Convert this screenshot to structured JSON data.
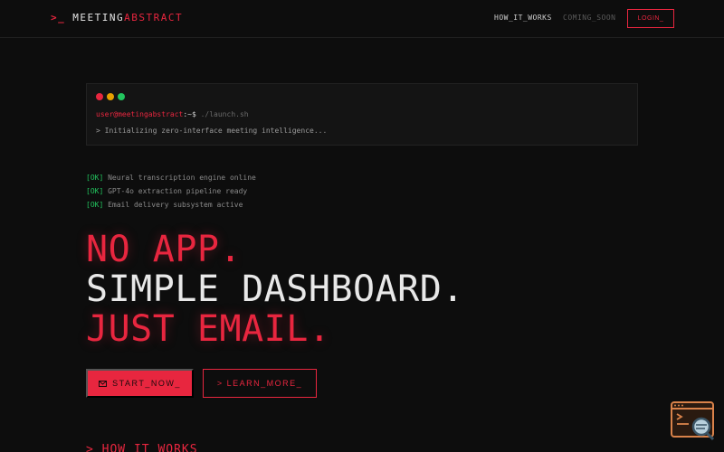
{
  "header": {
    "logo_prompt": ">_",
    "logo_part1": "MEETING",
    "logo_part2": "ABSTRACT",
    "nav": [
      {
        "label": "HOW_IT_WORKS"
      },
      {
        "label": "COMING_SOON"
      }
    ],
    "login_label": "LOGIN_"
  },
  "terminal": {
    "user": "user@meetingabstract",
    "path": ":~$",
    "command": " ./launch.sh",
    "output": "> Initializing zero-interface meeting intelligence..."
  },
  "status": [
    {
      "tag": "[OK]",
      "text": " Neural transcription engine online"
    },
    {
      "tag": "[OK]",
      "text": " GPT-4o extraction pipeline ready"
    },
    {
      "tag": "[OK]",
      "text": " Email delivery subsystem active"
    }
  ],
  "hero": {
    "line1": "NO APP.",
    "line2": "SIMPLE DASHBOARD.",
    "line3": "JUST EMAIL."
  },
  "cta": {
    "start_label": "START_NOW_",
    "learn_label": "> LEARN_MORE_"
  },
  "next_section_heading": "> HOW_IT_WORKS",
  "colors": {
    "accent": "#e8263f",
    "ok": "#22c55e",
    "background": "#0d0d0d"
  },
  "icons": {
    "start_icon": "mail-icon",
    "widget_icon": "terminal-search-icon"
  }
}
